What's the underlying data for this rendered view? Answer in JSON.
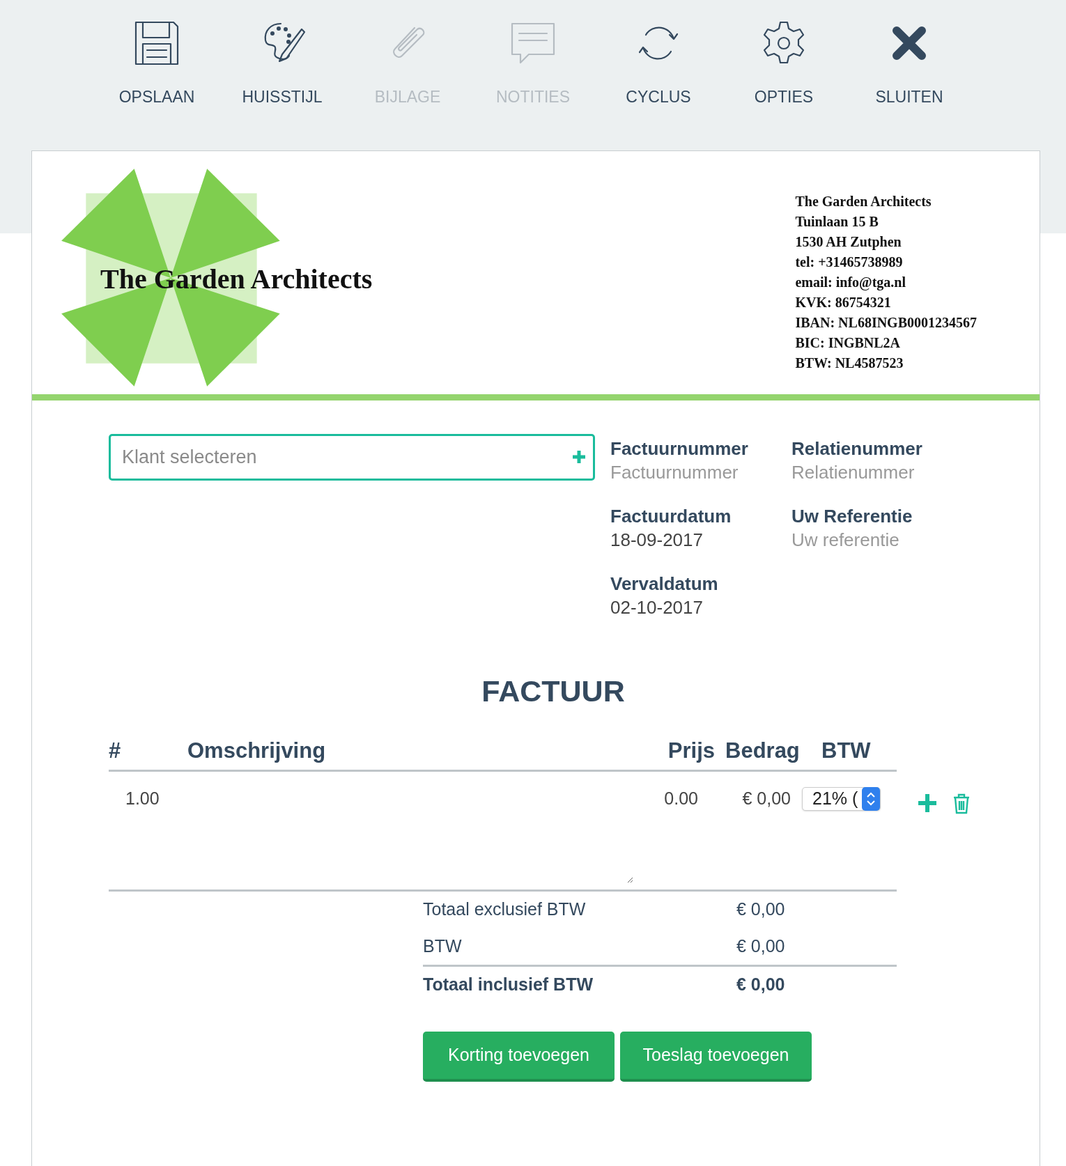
{
  "toolbar": [
    {
      "kind": "save",
      "label": "OPSLAAN",
      "disabled": false
    },
    {
      "kind": "style",
      "label": "HUISSTIJL",
      "disabled": false
    },
    {
      "kind": "attachment",
      "label": "BIJLAGE",
      "disabled": true
    },
    {
      "kind": "notes",
      "label": "NOTITIES",
      "disabled": true
    },
    {
      "kind": "cycle",
      "label": "CYCLUS",
      "disabled": false
    },
    {
      "kind": "options",
      "label": "OPTIES",
      "disabled": false
    },
    {
      "kind": "close",
      "label": "SLUITEN",
      "disabled": false
    }
  ],
  "letterhead": {
    "logo_text": "The Garden Architects",
    "address": [
      "The Garden Architects",
      "Tuinlaan 15 B",
      "1530 AH Zutphen",
      "tel: +31465738989",
      "email: info@tga.nl",
      "KVK: 86754321",
      "IBAN: NL68INGB0001234567",
      "BIC: INGBNL2A",
      "BTW: NL4587523"
    ]
  },
  "client_field": {
    "placeholder": "Klant selecteren"
  },
  "meta_fields": [
    {
      "label": "Factuurnummer",
      "placeholder": "Factuurnummer"
    },
    {
      "label": "Relatienummer",
      "placeholder": "Relatienummer"
    },
    {
      "label": "Factuurdatum",
      "value": "18-09-2017"
    },
    {
      "label": "Uw Referentie",
      "placeholder": "Uw referentie"
    },
    {
      "label": "Vervaldatum",
      "value": "02-10-2017"
    }
  ],
  "title": "FACTUUR",
  "table": {
    "columns": [
      "#",
      "Omschrijving",
      "Prijs",
      "Bedrag",
      "BTW"
    ],
    "rows": [
      {
        "number": "1.00",
        "price": "0.00",
        "amount": "€ 0,00",
        "vat": "21% ("
      }
    ]
  },
  "totals": [
    {
      "kind": "subtotal",
      "label": "Totaal exclusief BTW",
      "amount": "€ 0,00"
    },
    {
      "kind": "subtotal",
      "label": "BTW",
      "amount": "€ 0,00"
    },
    {
      "kind": "total",
      "label": "Totaal inclusief BTW",
      "amount": "€ 0,00"
    }
  ],
  "buttons": [
    "Korting toevoegen",
    "Toeslag toevoegen"
  ]
}
